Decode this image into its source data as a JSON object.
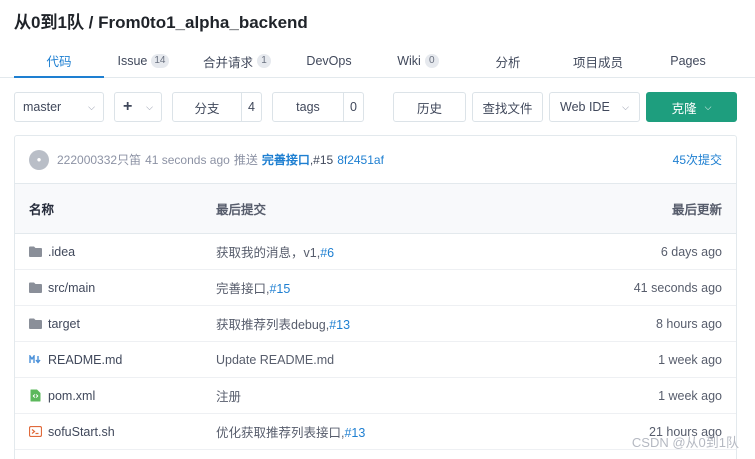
{
  "repo": {
    "title": "从0到1队 / From0to1_alpha_backend"
  },
  "tabs": [
    {
      "label": "代码",
      "active": true
    },
    {
      "label": "Issue",
      "count": "14"
    },
    {
      "label": "合并请求",
      "count": "1"
    },
    {
      "label": "DevOps"
    },
    {
      "label": "Wiki",
      "count": "0"
    },
    {
      "label": "分析"
    },
    {
      "label": "项目成员"
    },
    {
      "label": "Pages"
    }
  ],
  "toolbar": {
    "branch": "master",
    "add": "+",
    "branches_label": "分支",
    "branches_count": "4",
    "tags_label": "tags",
    "tags_count": "0",
    "history": "历史",
    "find_file": "查找文件",
    "web_ide": "Web IDE",
    "clone": "克隆"
  },
  "last_commit": {
    "author": "222000332只笛",
    "time": "41 seconds ago",
    "verb": "推送",
    "message": "完善接口",
    "pr": ",#15",
    "sha": "8f2451af",
    "total": "45次提交"
  },
  "table": {
    "headers": {
      "name": "名称",
      "commit": "最后提交",
      "updated": "最后更新"
    },
    "rows": [
      {
        "icon": "folder-icon",
        "name": ".idea",
        "commit": "获取我的消息，v1,",
        "ref": "#6",
        "time": "6 days ago"
      },
      {
        "icon": "folder-icon",
        "name": "src/main",
        "commit": "完善接口,",
        "ref": "#15",
        "time": "41 seconds ago"
      },
      {
        "icon": "folder-icon",
        "name": "target",
        "commit": "获取推荐列表debug,",
        "ref": "#13",
        "time": "8 hours ago"
      },
      {
        "icon": "markdown-icon",
        "name": "README.md",
        "commit": "Update README.md",
        "ref": "",
        "time": "1 week ago"
      },
      {
        "icon": "xml-file-icon",
        "name": "pom.xml",
        "commit": "注册",
        "ref": "",
        "time": "1 week ago"
      },
      {
        "icon": "shell-file-icon",
        "name": "sofuStart.sh",
        "commit": "优化获取推荐列表接口,",
        "ref": "#13",
        "time": "21 hours ago"
      }
    ]
  },
  "watermark": "CSDN @从0到1队",
  "colors": {
    "accent": "#1e7fd1",
    "clone": "#1e9e7e"
  }
}
